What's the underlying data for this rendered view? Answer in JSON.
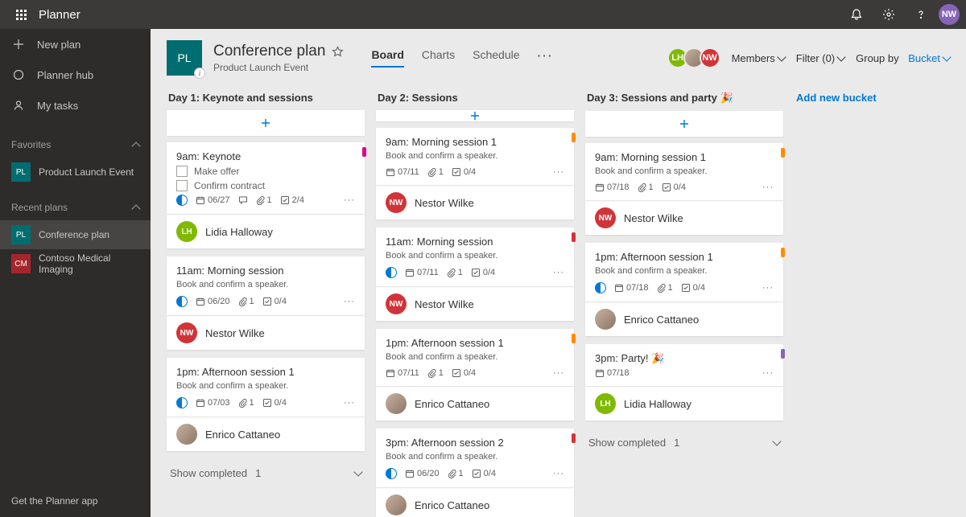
{
  "app": {
    "name": "Planner"
  },
  "user": {
    "initials": "NW"
  },
  "sidebar": {
    "new_plan": "New plan",
    "hub": "Planner hub",
    "my_tasks": "My tasks",
    "favorites": "Favorites",
    "fav_items": [
      {
        "badge": "PL",
        "name": "Product Launch Event",
        "color": "teal"
      }
    ],
    "recent": "Recent plans",
    "recent_items": [
      {
        "badge": "PL",
        "name": "Conference plan",
        "color": "teal",
        "active": true
      },
      {
        "badge": "CM",
        "name": "Contoso Medical Imaging",
        "color": "red"
      }
    ],
    "footer": "Get the Planner app"
  },
  "plan": {
    "badge": "PL",
    "title": "Conference plan",
    "subtitle": "Product Launch Event"
  },
  "tabs": [
    "Board",
    "Charts",
    "Schedule"
  ],
  "header": {
    "members": "Members",
    "filter": "Filter (0)",
    "group_by_label": "Group by",
    "group_by_value": "Bucket",
    "member_avatars": [
      "LH",
      "EC",
      "NW"
    ]
  },
  "buckets": [
    {
      "title": "Day 1: Keynote and sessions",
      "cards": [
        {
          "title": "9am: Keynote",
          "tag": "pink",
          "checks": [
            "Make offer",
            "Confirm contract"
          ],
          "progress": "half",
          "date": "06/27",
          "comment": true,
          "attach": "1",
          "tasks": "2/4",
          "assignee": {
            "type": "initials",
            "value": "LH",
            "style": "green",
            "name": "Lidia Halloway"
          }
        },
        {
          "title": "11am: Morning session",
          "desc": "Book and confirm a speaker.",
          "progress": "half",
          "date": "06/20",
          "attach": "1",
          "tasks": "0/4",
          "assignee": {
            "type": "initials",
            "value": "NW",
            "style": "red",
            "name": "Nestor Wilke"
          }
        },
        {
          "title": "1pm: Afternoon session 1",
          "desc": "Book and confirm a speaker.",
          "progress": "half",
          "date": "07/03",
          "attach": "1",
          "tasks": "0/4",
          "assignee": {
            "type": "photo",
            "name": "Enrico Cattaneo"
          }
        }
      ],
      "completed": "1"
    },
    {
      "title": "Day 2: Sessions",
      "cards": [
        {
          "title": "9am: Morning session 1",
          "desc": "Book and confirm a speaker.",
          "tag": "orange",
          "date": "07/11",
          "attach": "1",
          "tasks": "0/4",
          "assignee": {
            "type": "initials",
            "value": "NW",
            "style": "red",
            "name": "Nestor Wilke"
          }
        },
        {
          "title": "11am: Morning session",
          "desc": "Book and confirm a speaker.",
          "tag": "red",
          "progress": "half",
          "date": "07/11",
          "attach": "1",
          "tasks": "0/4",
          "assignee": {
            "type": "initials",
            "value": "NW",
            "style": "red",
            "name": "Nestor Wilke"
          }
        },
        {
          "title": "1pm: Afternoon session 1",
          "desc": "Book and confirm a speaker.",
          "tag": "orange",
          "date": "07/11",
          "attach": "1",
          "tasks": "0/4",
          "assignee": {
            "type": "photo",
            "name": "Enrico Cattaneo"
          }
        },
        {
          "title": "3pm: Afternoon session 2",
          "desc": "Book and confirm a speaker.",
          "tag": "red",
          "progress": "half",
          "date": "06/20",
          "attach": "1",
          "tasks": "0/4",
          "assignee": {
            "type": "photo",
            "name": "Enrico Cattaneo"
          }
        }
      ]
    },
    {
      "title": "Day 3: Sessions and party 🎉",
      "cards": [
        {
          "title": "9am: Morning session 1",
          "desc": "Book and confirm a speaker.",
          "tag": "orange",
          "date": "07/18",
          "attach": "1",
          "tasks": "0/4",
          "assignee": {
            "type": "initials",
            "value": "NW",
            "style": "red",
            "name": "Nestor Wilke"
          }
        },
        {
          "title": "1pm: Afternoon session 1",
          "desc": "Book and confirm a speaker.",
          "tag": "orange",
          "progress": "half",
          "date": "07/18",
          "attach": "1",
          "tasks": "0/4",
          "assignee": {
            "type": "photo",
            "name": "Enrico Cattaneo"
          }
        },
        {
          "title": "3pm: Party! 🎉",
          "tag": "purple",
          "date": "07/18",
          "assignee": {
            "type": "initials",
            "value": "LH",
            "style": "green",
            "name": "Lidia Halloway"
          }
        }
      ],
      "completed": "1"
    }
  ],
  "strings": {
    "show_completed": "Show completed",
    "add_bucket": "Add new bucket"
  }
}
